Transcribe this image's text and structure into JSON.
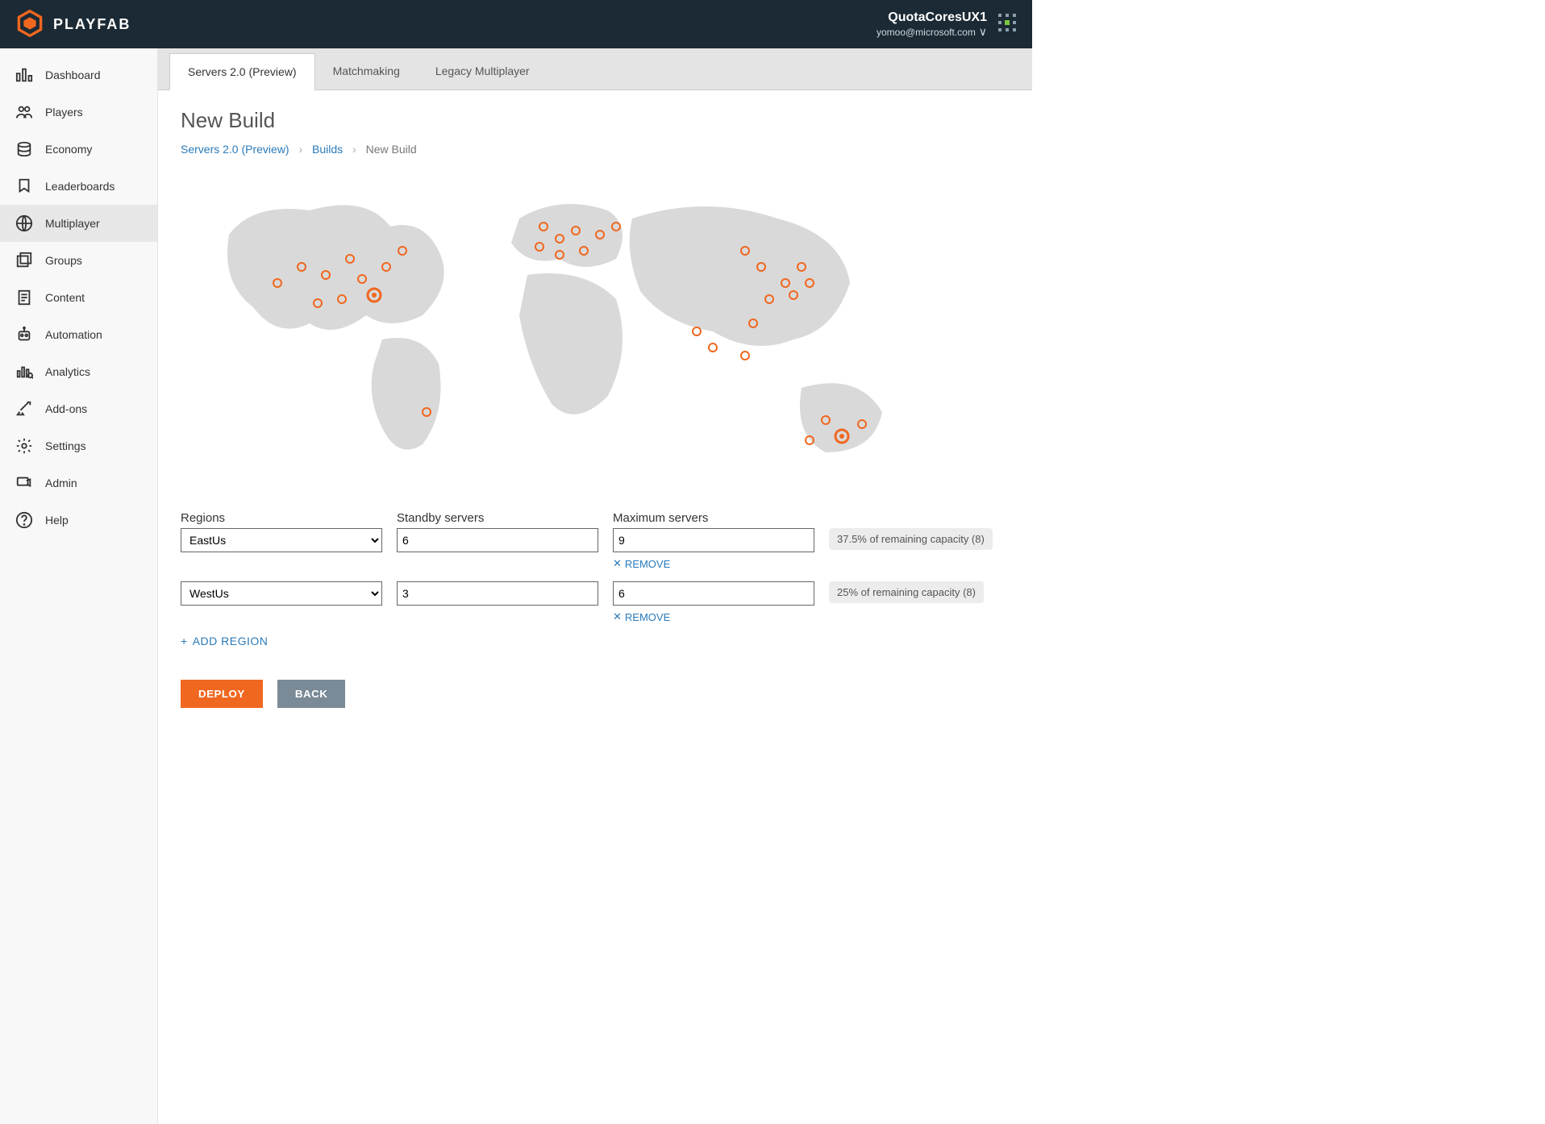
{
  "brand": {
    "name": "PLAYFAB"
  },
  "account": {
    "title": "QuotaCoresUX1",
    "email": "yomoo@microsoft.com"
  },
  "sidebar": {
    "items": [
      {
        "id": "dashboard",
        "label": "Dashboard"
      },
      {
        "id": "players",
        "label": "Players"
      },
      {
        "id": "economy",
        "label": "Economy"
      },
      {
        "id": "leaderboards",
        "label": "Leaderboards"
      },
      {
        "id": "multiplayer",
        "label": "Multiplayer",
        "active": true
      },
      {
        "id": "groups",
        "label": "Groups"
      },
      {
        "id": "content",
        "label": "Content"
      },
      {
        "id": "automation",
        "label": "Automation"
      },
      {
        "id": "analytics",
        "label": "Analytics"
      },
      {
        "id": "addons",
        "label": "Add-ons"
      },
      {
        "id": "settings",
        "label": "Settings"
      },
      {
        "id": "admin",
        "label": "Admin"
      },
      {
        "id": "help",
        "label": "Help"
      }
    ]
  },
  "tabs": [
    {
      "id": "servers",
      "label": "Servers 2.0 (Preview)",
      "active": true
    },
    {
      "id": "matchmaking",
      "label": "Matchmaking"
    },
    {
      "id": "legacy",
      "label": "Legacy Multiplayer"
    }
  ],
  "page": {
    "title": "New Build"
  },
  "breadcrumb": {
    "link1": "Servers 2.0 (Preview)",
    "link2": "Builds",
    "current": "New Build"
  },
  "columns": {
    "regions": "Regions",
    "standby": "Standby servers",
    "maximum": "Maximum servers"
  },
  "rows": [
    {
      "region": "EastUs",
      "standby": "6",
      "maximum": "9",
      "capacity": "37.5% of remaining capacity (8)"
    },
    {
      "region": "WestUs",
      "standby": "3",
      "maximum": "6",
      "capacity": "25% of remaining capacity (8)"
    }
  ],
  "actions": {
    "remove": "REMOVE",
    "add_region": "ADD REGION",
    "deploy": "DEPLOY",
    "back": "BACK"
  }
}
